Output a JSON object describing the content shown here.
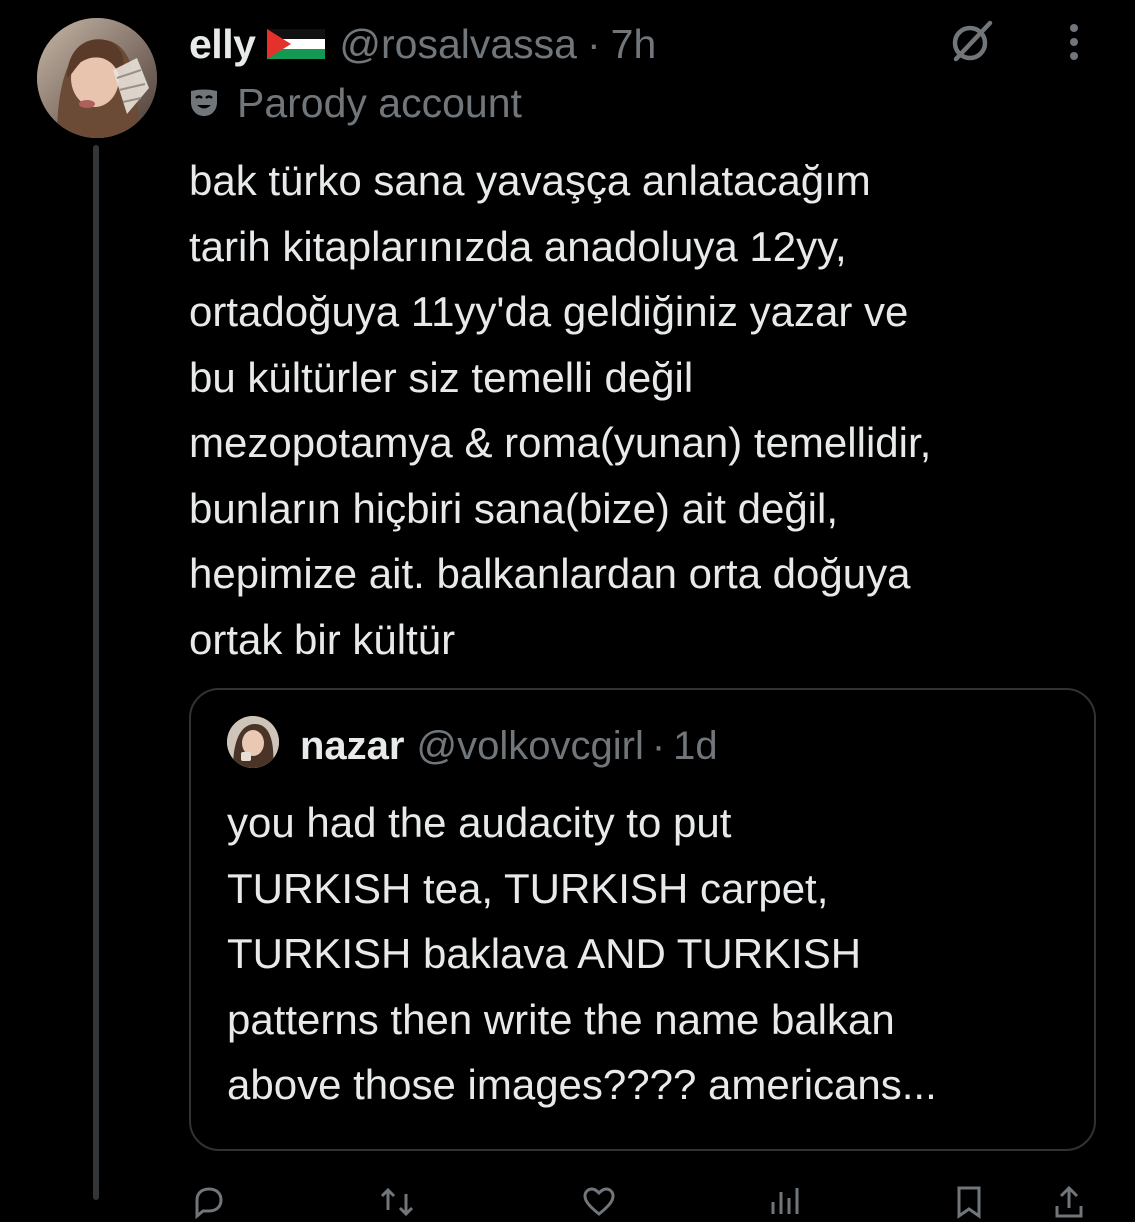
{
  "tweet": {
    "author": {
      "display_name": "elly",
      "flag_icon": "palestine-flag-icon",
      "handle": "@rosalvassa",
      "separator": "·",
      "time": "7h",
      "label": "Parody account"
    },
    "text_lines": [
      "bak türko sana yavaşça anlatacağım",
      "tarih kitaplarınızda anadoluya 12yy,",
      "ortadoğuya 11yy'da geldiğiniz yazar ve",
      "bu kültürler siz temelli değil",
      "mezopotamya & roma(yunan) temellidir,",
      "bunların hiçbiri sana(bize) ait değil,",
      "hepimize ait. balkanlardan orta doğuya",
      "ortak bir kültür"
    ],
    "quote": {
      "display_name": "nazar",
      "handle": "@volkovcgirl",
      "separator": "·",
      "time": "1d",
      "text_lines": [
        "you had the audacity to put",
        "TURKISH tea, TURKISH carpet,",
        "TURKISH baklava AND TURKISH",
        "patterns then write the name balkan",
        "above those images???? americans..."
      ]
    }
  },
  "icons": {
    "top_right": [
      "grok-icon",
      "more-icon"
    ],
    "actions": [
      "reply-icon",
      "retweet-icon",
      "like-icon",
      "views-icon",
      "bookmark-icon",
      "share-icon"
    ]
  },
  "colors": {
    "background": "#000000",
    "text": "#e7e9ea",
    "secondary": "#71767b",
    "border": "#2f3336"
  }
}
